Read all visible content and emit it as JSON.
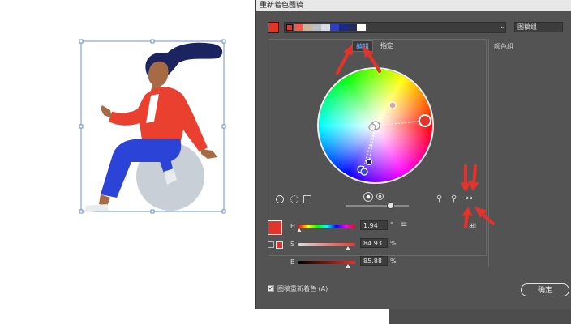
{
  "dialog": {
    "title": "重新着色图稿",
    "group_dropdown_value": "图稿组",
    "color_groups_label": "颜色组",
    "tabs": [
      {
        "label": "编辑",
        "active": true
      },
      {
        "label": "指定",
        "active": false
      }
    ],
    "hsb": {
      "h_label": "H",
      "h_value": "1.94",
      "h_unit": "°",
      "s_label": "S",
      "s_value": "84.93",
      "s_unit": "%",
      "b_label": "B",
      "b_value": "85.88",
      "b_unit": "%"
    },
    "recolor_checkbox_label": "图稿重新着色 (A)",
    "recolor_checked": true,
    "ok_label": "确定",
    "swatch_colors": [
      "#e6332a",
      "#f05a4a",
      "#c9b59a",
      "#b9bec6",
      "#d7dbe3",
      "#2d3ec8",
      "#1a2a8c",
      "#232a5e",
      "#ffffff"
    ],
    "active_color": "#e3342c"
  },
  "colors": {
    "dialog_bg": "#535353",
    "annotation_arrow": "#e5322a",
    "selection_blue": "#4a78c8"
  }
}
